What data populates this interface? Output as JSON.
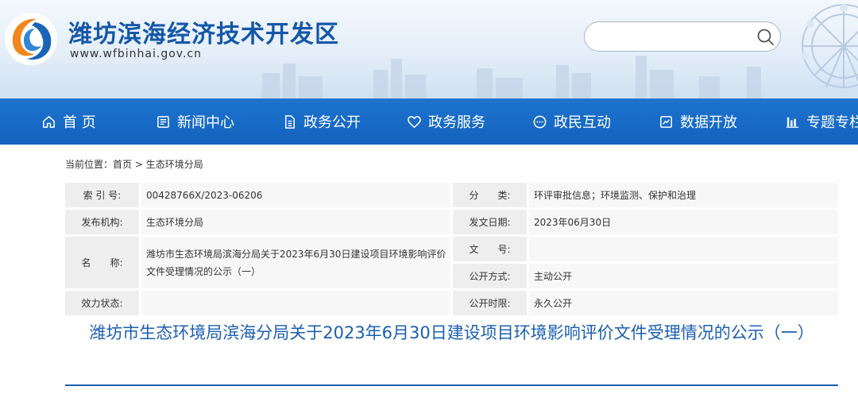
{
  "header": {
    "site_title": "潍坊滨海经济技术开发区",
    "site_url": "www.wfbinhai.gov.cn",
    "search_value": "",
    "logo_icon": "wave-logo-icon",
    "colors": {
      "brand_blue": "#1557a8",
      "nav_blue": "#1e74cf",
      "logo_orange": "#f0861c"
    }
  },
  "nav": {
    "items": [
      {
        "label": "首 页",
        "icon": "home-icon"
      },
      {
        "label": "新闻中心",
        "icon": "newspaper-icon"
      },
      {
        "label": "政务公开",
        "icon": "document-icon"
      },
      {
        "label": "政务服务",
        "icon": "heart-icon"
      },
      {
        "label": "政民互动",
        "icon": "chat-bubble-icon"
      },
      {
        "label": "数据开放",
        "icon": "chart-edit-icon"
      },
      {
        "label": "专题专栏",
        "icon": "bar-chart-icon"
      }
    ]
  },
  "breadcrumb": {
    "prefix": "当前位置：",
    "home": "首页",
    "separator": " > ",
    "current": "生态环境分局"
  },
  "meta": {
    "index_no_label": "索 引 号:",
    "index_no_value": "00428766X/2023-06206",
    "category_label": "分　　类:",
    "category_value": "环评审批信息；环境监测、保护和治理",
    "publisher_label": "发布机构:",
    "publisher_value": "生态环境分局",
    "date_label": "发文日期:",
    "date_value": "2023年06月30日",
    "name_label": "名　　称:",
    "name_value": "潍坊市生态环境局滨海分局关于2023年6月30日建设项目环境影响评价文件受理情况的公示（一）",
    "doc_no_label": "文　　号:",
    "doc_no_value": "",
    "open_mode_label": "公开方式:",
    "open_mode_value": "主动公开",
    "validity_label": "效力状态:",
    "validity_value": "",
    "open_period_label": "公开时限:",
    "open_period_value": "永久公开"
  },
  "article": {
    "title": "潍坊市生态环境局滨海分局关于2023年6月30日建设项目环境影响评价文件受理情况的公示（一）"
  }
}
